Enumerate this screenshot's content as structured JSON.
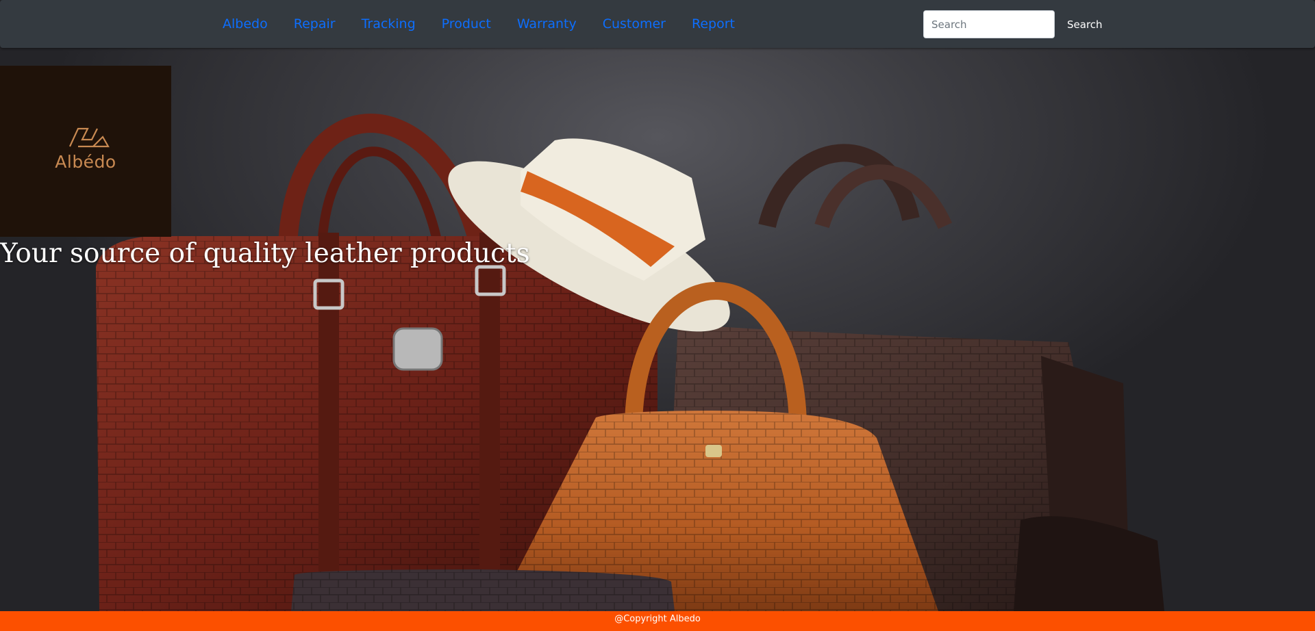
{
  "nav": {
    "items": [
      {
        "label": "Albedo"
      },
      {
        "label": "Repair"
      },
      {
        "label": "Tracking"
      },
      {
        "label": "Product"
      },
      {
        "label": "Warranty"
      },
      {
        "label": "Customer"
      },
      {
        "label": "Report"
      }
    ],
    "search_placeholder": "Search",
    "search_button": "Search"
  },
  "logo": {
    "text": "Albédo"
  },
  "hero": {
    "image_subject": "leather-goods-photo",
    "tagline": "Your source of quality leather products"
  },
  "footer": {
    "text": "@Copyright Albedo"
  },
  "colors": {
    "navbar_bg": "#343a40",
    "nav_link": "#0d6efd",
    "logo_bg": "#1f1209",
    "logo_accent": "#c98a52",
    "footer_bg": "#fc5000"
  }
}
